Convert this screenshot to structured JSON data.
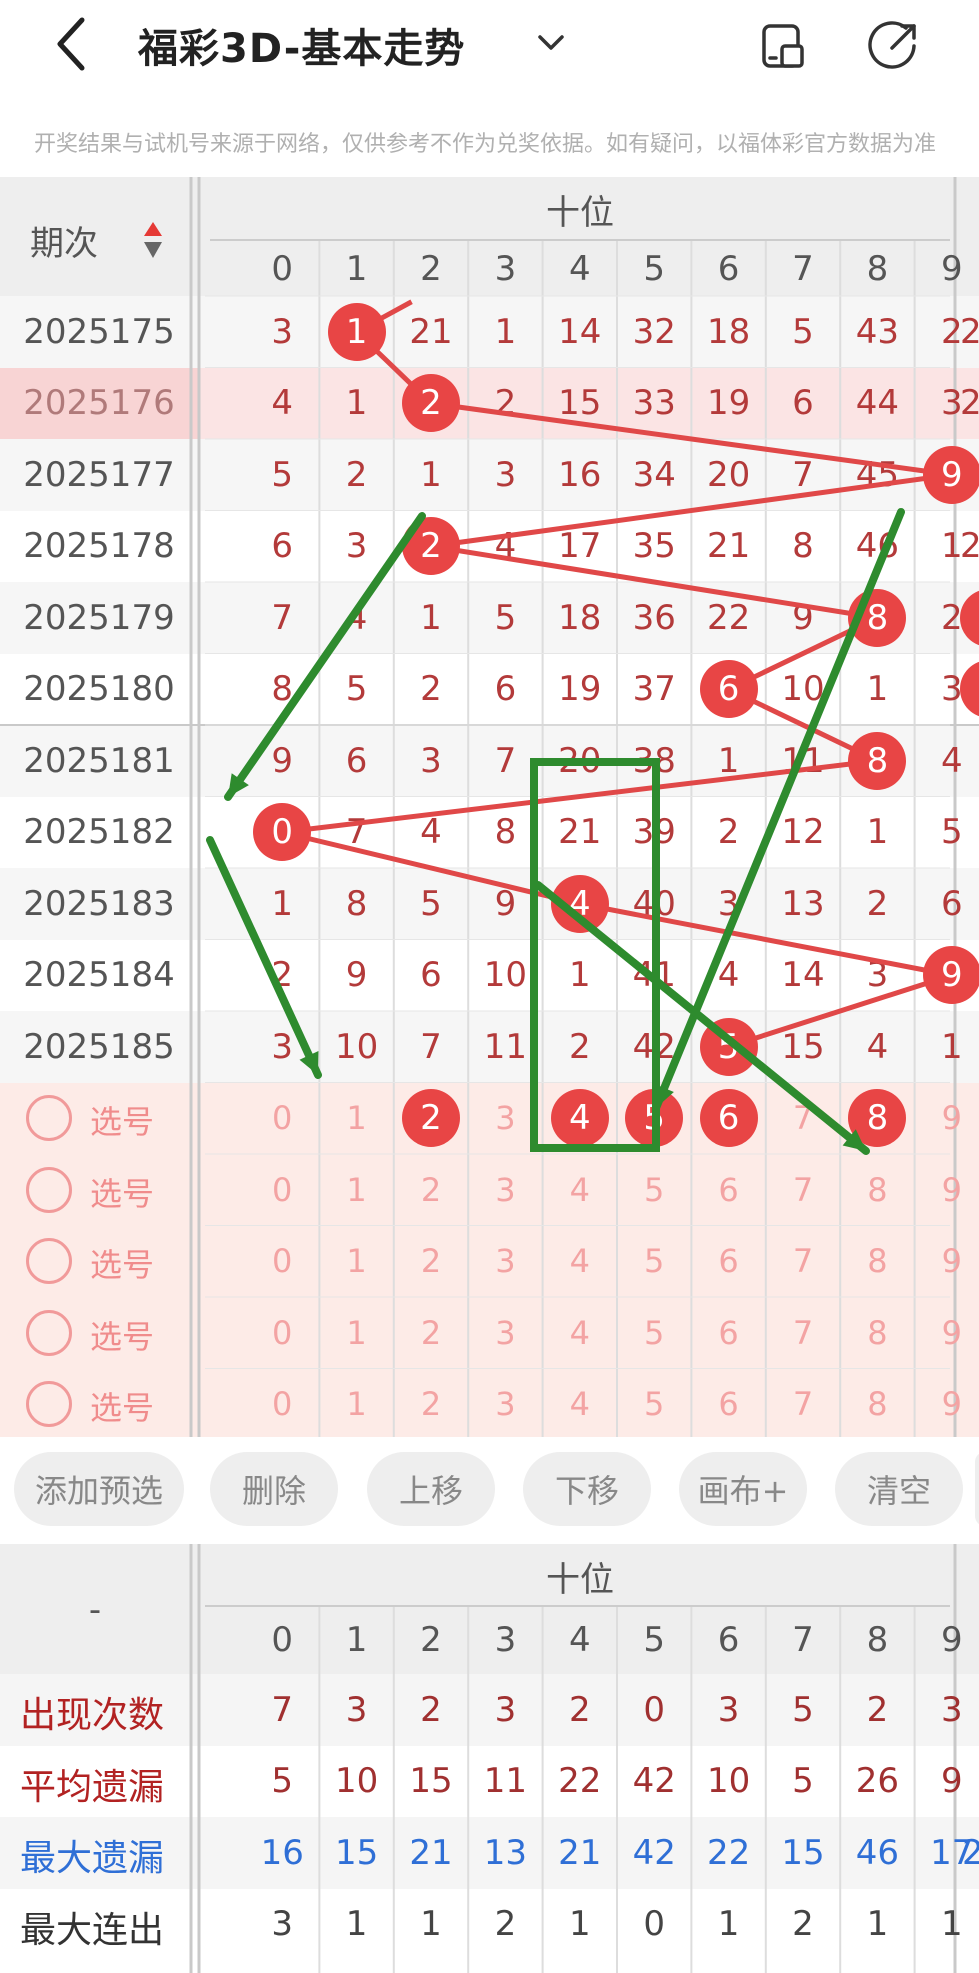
{
  "header": {
    "title": "福彩3D-基本走势"
  },
  "notice": "开奖结果与试机号来源于网络，仅供参考不作为兑奖依据。如有疑问，以福体彩官方数据为准",
  "table": {
    "period_header": "期次",
    "group_label": "十位",
    "digits": [
      "0",
      "1",
      "2",
      "3",
      "4",
      "5",
      "6",
      "7",
      "8",
      "9"
    ],
    "rows": [
      {
        "period": "2025175",
        "cells": [
          "3",
          "1",
          "21",
          "1",
          "14",
          "32",
          "18",
          "5",
          "43",
          "2"
        ],
        "hit": 1,
        "right_edge": "2"
      },
      {
        "period": "2025176",
        "cells": [
          "4",
          "1",
          "2",
          "2",
          "15",
          "33",
          "19",
          "6",
          "44",
          "3"
        ],
        "hit": 2,
        "right_edge": "2",
        "highlight": true
      },
      {
        "period": "2025177",
        "cells": [
          "5",
          "2",
          "1",
          "3",
          "16",
          "34",
          "20",
          "7",
          "45",
          "9"
        ],
        "hit": 9,
        "right_edge": "2"
      },
      {
        "period": "2025178",
        "cells": [
          "6",
          "3",
          "2",
          "4",
          "17",
          "35",
          "21",
          "8",
          "46",
          "1"
        ],
        "hit": 2,
        "right_edge": "2"
      },
      {
        "period": "2025179",
        "cells": [
          "7",
          "4",
          "1",
          "5",
          "18",
          "36",
          "22",
          "9",
          "8",
          "2"
        ],
        "hit": 8,
        "right_edge": ""
      },
      {
        "period": "2025180",
        "cells": [
          "8",
          "5",
          "2",
          "6",
          "19",
          "37",
          "6",
          "10",
          "1",
          "3"
        ],
        "hit": 6,
        "right_edge": ""
      },
      {
        "period": "2025181",
        "cells": [
          "9",
          "6",
          "3",
          "7",
          "20",
          "38",
          "1",
          "11",
          "8",
          "4"
        ],
        "hit": 8,
        "right_edge": ""
      },
      {
        "period": "2025182",
        "cells": [
          "0",
          "7",
          "4",
          "8",
          "21",
          "39",
          "2",
          "12",
          "1",
          "5"
        ],
        "hit": 0,
        "right_edge": ""
      },
      {
        "period": "2025183",
        "cells": [
          "1",
          "8",
          "5",
          "9",
          "4",
          "40",
          "3",
          "13",
          "2",
          "6"
        ],
        "hit": 4,
        "right_edge": ""
      },
      {
        "period": "2025184",
        "cells": [
          "2",
          "9",
          "6",
          "10",
          "1",
          "41",
          "4",
          "14",
          "3",
          "9"
        ],
        "hit": 9,
        "right_edge": ""
      },
      {
        "period": "2025185",
        "cells": [
          "3",
          "10",
          "7",
          "11",
          "2",
          "42",
          "5",
          "15",
          "4",
          "1"
        ],
        "hit": 6,
        "right_edge": ""
      }
    ]
  },
  "picks": {
    "label": "选号",
    "digits": [
      "0",
      "1",
      "2",
      "3",
      "4",
      "5",
      "6",
      "7",
      "8",
      "9"
    ],
    "rows": [
      {
        "selected": [
          2,
          4,
          5,
          6,
          8
        ]
      },
      {
        "selected": []
      },
      {
        "selected": []
      },
      {
        "selected": []
      },
      {
        "selected": []
      }
    ]
  },
  "buttons": [
    "添加预选",
    "删除",
    "上移",
    "下移",
    "画布+",
    "清空"
  ],
  "stats": {
    "corner": "-",
    "group_label": "十位",
    "digits": [
      "0",
      "1",
      "2",
      "3",
      "4",
      "5",
      "6",
      "7",
      "8",
      "9"
    ],
    "rows": [
      {
        "label": "出现次数",
        "color": "#b22222",
        "values": [
          "7",
          "3",
          "2",
          "3",
          "2",
          "0",
          "3",
          "5",
          "2",
          "3"
        ]
      },
      {
        "label": "平均遗漏",
        "color": "#b22222",
        "values": [
          "5",
          "10",
          "15",
          "11",
          "22",
          "42",
          "10",
          "5",
          "26",
          "9"
        ]
      },
      {
        "label": "最大遗漏",
        "color": "#2f6fd6",
        "values": [
          "16",
          "15",
          "21",
          "13",
          "21",
          "42",
          "22",
          "15",
          "46",
          "17"
        ],
        "right_edge": "2"
      },
      {
        "label": "最大连出",
        "color": "#333333",
        "values": [
          "3",
          "1",
          "1",
          "2",
          "1",
          "0",
          "1",
          "2",
          "1",
          "1"
        ]
      }
    ]
  },
  "colors": {
    "ball": "#e84545",
    "line": "#e04848",
    "annotation": "#2e8b2e",
    "pick_bg": "#fdebe7",
    "highlight_row": "#f8d4d4"
  }
}
